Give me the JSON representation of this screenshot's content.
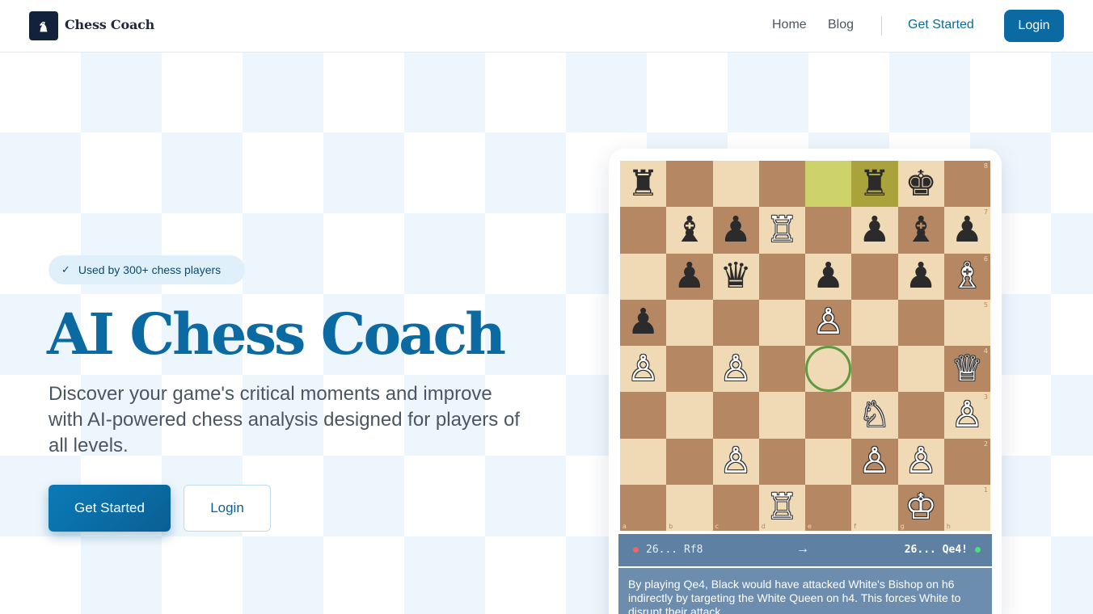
{
  "header": {
    "brand": "Chess Coach",
    "logo_icon": "knight-icon",
    "nav": [
      {
        "label": "Home"
      },
      {
        "label": "Blog"
      }
    ],
    "cta_label": "Get Started",
    "login_label": "Login"
  },
  "hero": {
    "badge_check": "✓",
    "badge_text": "Used by 300+ chess players",
    "title": "AI Chess Coach",
    "subtitle": "Discover your game's critical moments and improve with AI-powered chess analysis designed for players of all levels.",
    "primary_button": "Get Started",
    "secondary_button": "Login"
  },
  "board": {
    "files": [
      "a",
      "b",
      "c",
      "d",
      "e",
      "f",
      "g",
      "h"
    ],
    "ranks": [
      "8",
      "7",
      "6",
      "5",
      "4",
      "3",
      "2",
      "1"
    ],
    "highlight_squares": [
      "e8",
      "f8"
    ],
    "target_square": "e4",
    "pieces": [
      {
        "sq": "a8",
        "glyph": "♜",
        "color": "b"
      },
      {
        "sq": "f8",
        "glyph": "♜",
        "color": "b"
      },
      {
        "sq": "g8",
        "glyph": "♚",
        "color": "b"
      },
      {
        "sq": "b7",
        "glyph": "♝",
        "color": "b"
      },
      {
        "sq": "c7",
        "glyph": "♟",
        "color": "b"
      },
      {
        "sq": "d7",
        "glyph": "♖",
        "color": "w"
      },
      {
        "sq": "f7",
        "glyph": "♟",
        "color": "b"
      },
      {
        "sq": "g7",
        "glyph": "♝",
        "color": "b"
      },
      {
        "sq": "h7",
        "glyph": "♟",
        "color": "b"
      },
      {
        "sq": "b6",
        "glyph": "♟",
        "color": "b"
      },
      {
        "sq": "c6",
        "glyph": "♛",
        "color": "b"
      },
      {
        "sq": "e6",
        "glyph": "♟",
        "color": "b"
      },
      {
        "sq": "g6",
        "glyph": "♟",
        "color": "b"
      },
      {
        "sq": "h6",
        "glyph": "♗",
        "color": "w"
      },
      {
        "sq": "a5",
        "glyph": "♟",
        "color": "b"
      },
      {
        "sq": "e5",
        "glyph": "♙",
        "color": "w"
      },
      {
        "sq": "a4",
        "glyph": "♙",
        "color": "w"
      },
      {
        "sq": "c4",
        "glyph": "♙",
        "color": "w"
      },
      {
        "sq": "h4",
        "glyph": "♕",
        "color": "w"
      },
      {
        "sq": "f3",
        "glyph": "♘",
        "color": "w"
      },
      {
        "sq": "h3",
        "glyph": "♙",
        "color": "w"
      },
      {
        "sq": "c2",
        "glyph": "♙",
        "color": "w"
      },
      {
        "sq": "f2",
        "glyph": "♙",
        "color": "w"
      },
      {
        "sq": "g2",
        "glyph": "♙",
        "color": "w"
      },
      {
        "sq": "d1",
        "glyph": "♖",
        "color": "w"
      },
      {
        "sq": "g1",
        "glyph": "♔",
        "color": "w"
      }
    ]
  },
  "moves": {
    "played": "26... Rf8",
    "arrow": "→",
    "best": "26... Qe4!"
  },
  "explanation": "By playing Qe4, Black would have attacked White's Bishop on h6 indirectly by targeting the White Queen on h4. This forces White to disrupt their attack.",
  "colors": {
    "accent": "#0a6aa1",
    "light_square": "#f0d9b5",
    "dark_square": "#b58863",
    "highlight": "#cdd26a",
    "move_bar": "#5e80a3"
  }
}
